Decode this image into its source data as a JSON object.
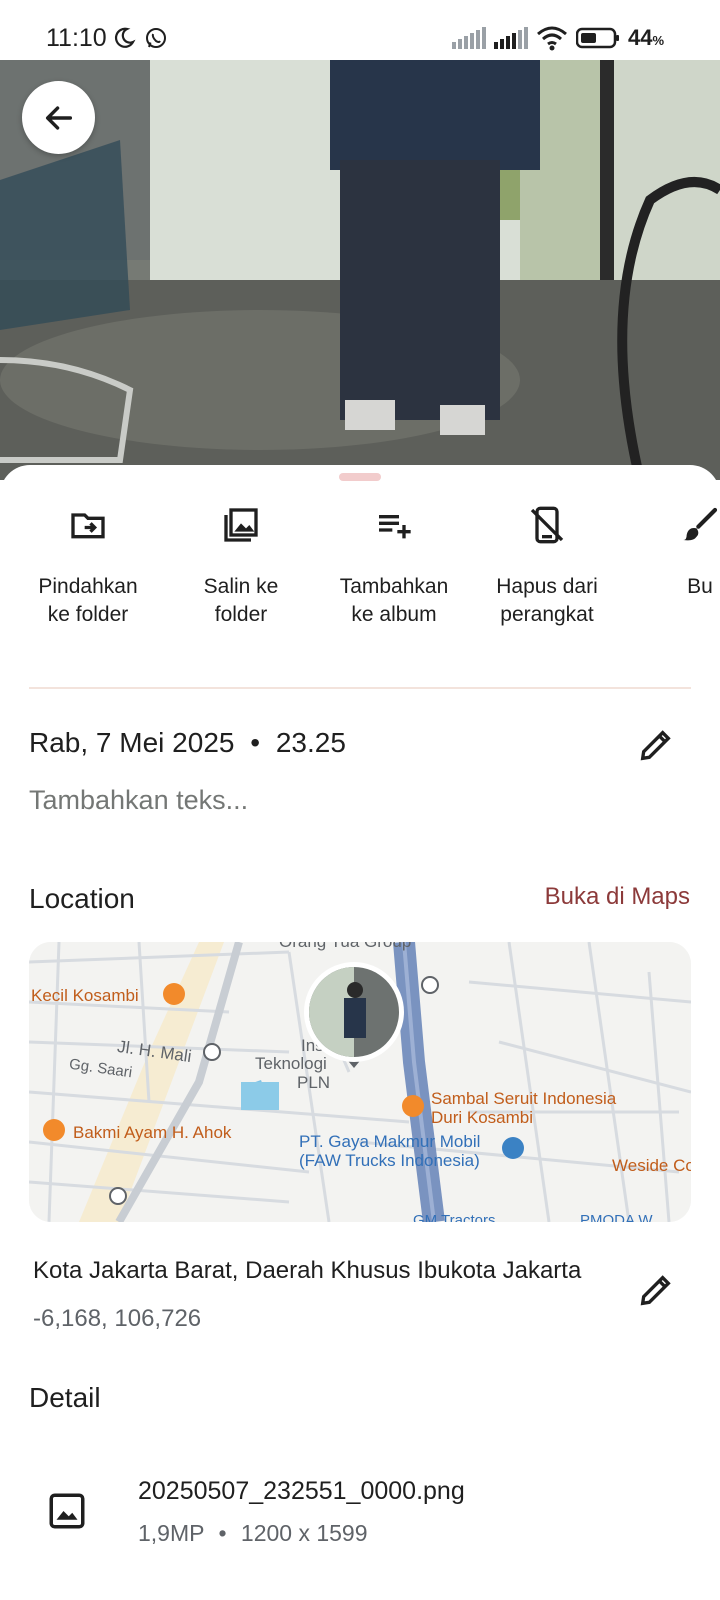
{
  "status_bar": {
    "time": "11:10",
    "battery_percent": "44",
    "battery_unit": "%",
    "icons": [
      "moon-icon",
      "whatsapp-icon",
      "signal-icon",
      "signal-icon",
      "wifi-icon",
      "battery-icon"
    ]
  },
  "photo": {
    "icon": "back-arrow-icon"
  },
  "actions": [
    {
      "label": "Pindahkan\nke folder",
      "icon": "move-to-folder-icon"
    },
    {
      "label": "Salin ke\nfolder",
      "icon": "copy-to-folder-icon"
    },
    {
      "label": "Tambahkan\nke album",
      "icon": "add-to-album-icon"
    },
    {
      "label": "Hapus dari\nperangkat",
      "icon": "delete-from-device-icon"
    },
    {
      "label": "Bu",
      "icon": "brush-icon"
    }
  ],
  "info": {
    "date": "Rab, 7 Mei 2025",
    "separator": "•",
    "time": "23.25",
    "add_text_placeholder": "Tambahkan teks..."
  },
  "location": {
    "title": "Location",
    "open_maps": "Buka di Maps",
    "map_labels": {
      "top_street": "Orang Tua Group",
      "kecil_kosambi": "Kecil Kosambi",
      "jl_h_mali": "Jl. H. Mali",
      "gg_saari": "Gg. Saari",
      "institut_1": "Institut",
      "institut_2": "Teknologi",
      "institut_3": "PLN",
      "sambal_1": "Sambal Seruit Indonesia",
      "sambal_2": "Duri Kosambi",
      "bakmi": "Bakmi Ayam H. Ahok",
      "gaya_1": "PT. Gaya Makmur Mobil",
      "gaya_2": "(FAW Trucks Indonesia)",
      "weside": "Weside Cof",
      "gm_tractors": "GM Tractors",
      "pmoda": "PMODA W"
    },
    "address": "Kota Jakarta Barat, Daerah Khusus Ibukota Jakarta",
    "coordinates": "-6,168, 106,726"
  },
  "detail": {
    "title": "Detail",
    "filename": "20250507_232551_0000.png",
    "megapixels": "1,9MP",
    "separator": "•",
    "dimensions": "1200 x 1599"
  },
  "colors": {
    "accent_link": "#8c3a3a",
    "handle": "#f2cccc",
    "divider": "#f3e3dc",
    "map_background": "#f3f3f1",
    "map_highway": "#7a93c0"
  }
}
